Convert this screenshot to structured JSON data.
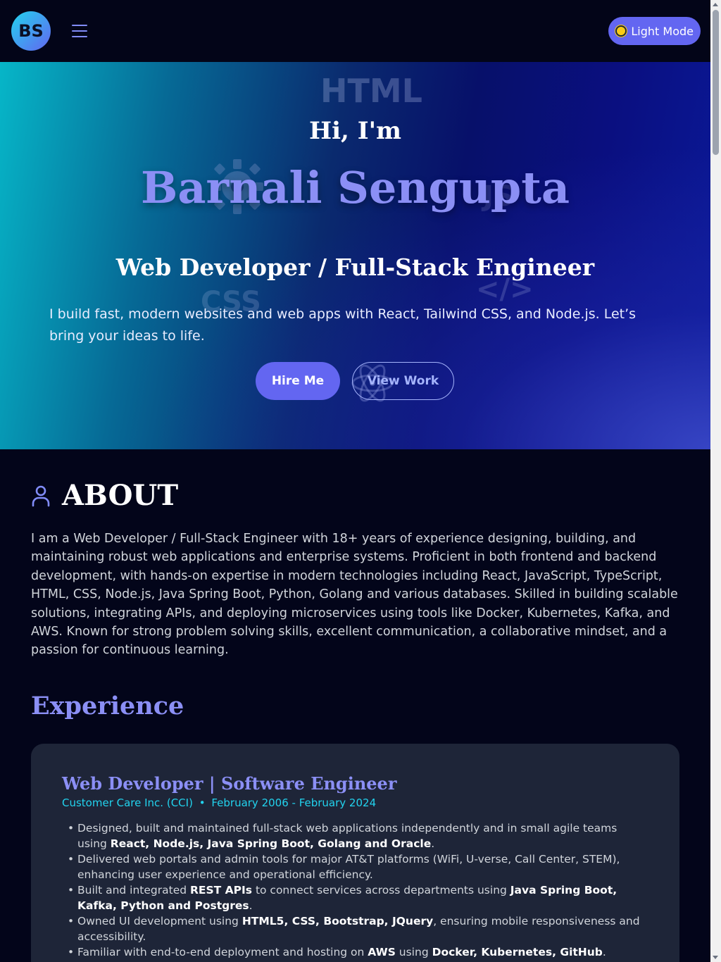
{
  "header": {
    "logo": "BS",
    "mode_button": "Light Mode"
  },
  "hero": {
    "ghost_html": "HTML",
    "ghost_css": "CSS",
    "ghost_code": "</>",
    "ghost_js": "JS",
    "greeting": "Hi, I'm",
    "name": "Barnali Sengupta",
    "role": "Web Developer / Full-Stack Engineer",
    "description": "I build fast, modern websites and web apps with React, Tailwind CSS, and Node.js. Let’s bring your ideas to life.",
    "hire_button": "Hire Me",
    "work_button": "View Work"
  },
  "about": {
    "title": "ABOUT",
    "text": "I am a Web Developer / Full-Stack Engineer with 18+ years of experience designing, building, and maintaining robust web applications and enterprise systems. Proficient in both frontend and backend development, with hands-on expertise in modern technologies including React, JavaScript, TypeScript, HTML, CSS, Node.js, Java Spring Boot, Python, Golang and various databases. Skilled in building scalable solutions, integrating APIs, and deploying microservices using tools like Docker, Kubernetes, Kafka, and AWS. Known for strong problem solving skills, excellent communication, a collaborative mindset, and a passion for continuous learning."
  },
  "experience": {
    "title": "Experience",
    "jobs": [
      {
        "title": "Web Developer | Software Engineer",
        "company": "Customer Care Inc. (CCI)",
        "separator": "•",
        "dates": "February 2006 - February 2024",
        "bullets": [
          {
            "pre": "Designed, built and maintained full-stack web applications independently and in small agile teams using ",
            "bold": "React, Node.js, Java Spring Boot, Golang and Oracle",
            "post": "."
          },
          {
            "pre": "Delivered web portals and admin tools for major AT&T platforms (WiFi, U-verse, Call Center, STEM), enhancing user experience and operational efficiency.",
            "bold": "",
            "post": ""
          },
          {
            "pre": "Built and integrated ",
            "bold": "REST APIs",
            "post": " to connect services across departments using ",
            "bold2": "Java Spring Boot, Kafka, Python and Postgres",
            "post2": "."
          },
          {
            "pre": "Owned UI development using ",
            "bold": "HTML5, CSS, Bootstrap, JQuery",
            "post": ", ensuring mobile responsiveness and accessibility."
          },
          {
            "pre": "Familiar with end-to-end deployment and hosting on ",
            "bold": "AWS",
            "post": " using ",
            "bold2": "Docker, Kubernetes, GitHub",
            "post2": "."
          }
        ]
      }
    ]
  },
  "colors": {
    "accent": "#6366f1",
    "name": "#8b8ff5",
    "cyan": "#22d3ee",
    "background": "#03051a",
    "card": "#1e2538"
  },
  "icons": [
    "menu-icon",
    "sun-icon",
    "user-icon",
    "gear-icon",
    "atom-icon"
  ]
}
